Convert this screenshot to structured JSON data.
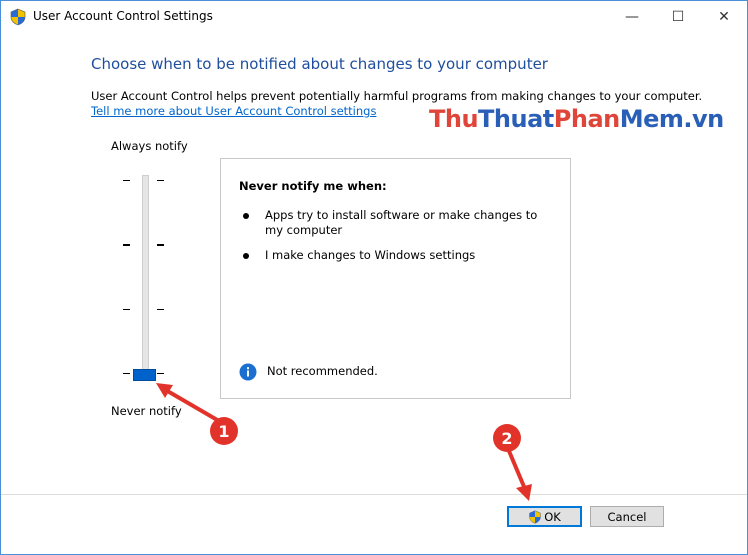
{
  "window": {
    "title": "User Account Control Settings",
    "minimize_glyph": "—",
    "maximize_glyph": "☐",
    "close_glyph": "✕"
  },
  "main": {
    "heading": "Choose when to be notified about changes to your computer",
    "description": "User Account Control helps prevent potentially harmful programs from making changes to your computer.",
    "learn_more_link": "Tell me more about User Account Control settings"
  },
  "watermark": {
    "part1": "Thu",
    "part2": "Thuat",
    "part3": "Phan",
    "part4": "Mem.vn"
  },
  "slider": {
    "top_label": "Always notify",
    "bottom_label": "Never notify",
    "levels": 4,
    "selected_level": 0
  },
  "info_panel": {
    "title": "Never notify me when:",
    "bullets": [
      "Apps try to install software or make changes to my computer",
      "I make changes to Windows settings"
    ],
    "note": "Not recommended."
  },
  "buttons": {
    "ok": "OK",
    "cancel": "Cancel"
  },
  "annotations": {
    "step1": "1",
    "step2": "2"
  },
  "colors": {
    "accent": "#0063cc",
    "heading": "#1f4e9e",
    "annotation": "#e2332b"
  }
}
